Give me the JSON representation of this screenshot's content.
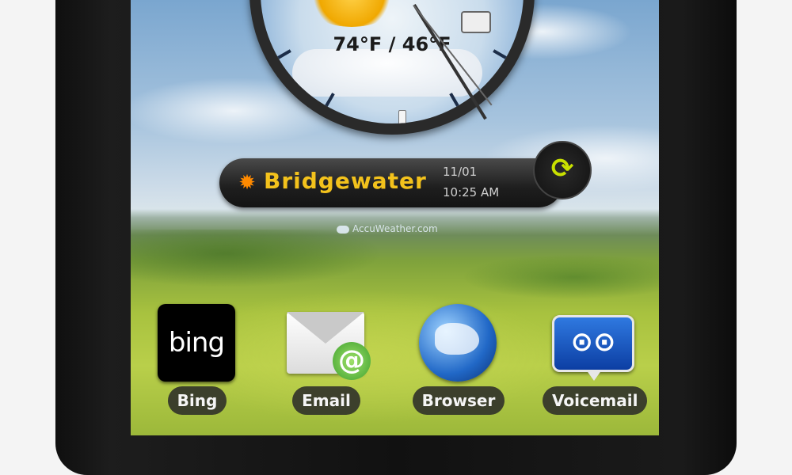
{
  "weather_widget": {
    "temps": "74°F / 46°F"
  },
  "location_bar": {
    "city": "Bridgewater",
    "date": "11/01",
    "time": "10:25 AM",
    "weather_icon": "sun-icon",
    "refresh_icon": "refresh-icon"
  },
  "provider_logo": "AccuWeather.com",
  "apps": [
    {
      "label": "Bing",
      "icon": "bing-icon",
      "icon_text": "bing"
    },
    {
      "label": "Email",
      "icon": "email-icon"
    },
    {
      "label": "Browser",
      "icon": "globe-icon"
    },
    {
      "label": "Voicemail",
      "icon": "voicemail-icon"
    }
  ],
  "colors": {
    "city_text": "#f3c21c",
    "refresh_accent": "#c8e000"
  }
}
